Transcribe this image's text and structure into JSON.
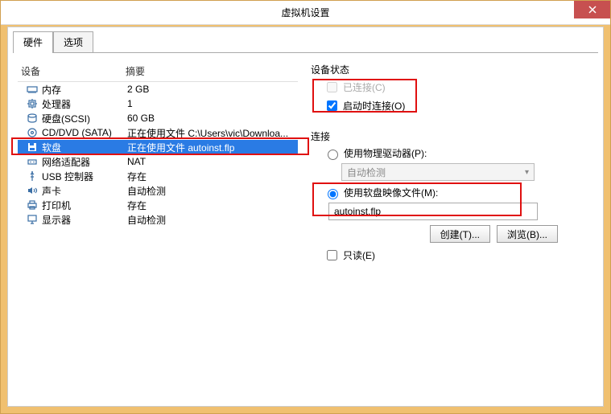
{
  "title": "虚拟机设置",
  "tabs": {
    "hardware": "硬件",
    "options": "选项"
  },
  "headers": {
    "device": "设备",
    "summary": "摘要"
  },
  "devices": [
    {
      "name": "内存",
      "summary": "2 GB",
      "icon": "memory"
    },
    {
      "name": "处理器",
      "summary": "1",
      "icon": "cpu"
    },
    {
      "name": "硬盘(SCSI)",
      "summary": "60 GB",
      "icon": "disk"
    },
    {
      "name": "CD/DVD (SATA)",
      "summary": "正在使用文件 C:\\Users\\vic\\Downloa...",
      "icon": "cd"
    },
    {
      "name": "软盘",
      "summary": "正在使用文件 autoinst.flp",
      "icon": "floppy"
    },
    {
      "name": "网络适配器",
      "summary": "NAT",
      "icon": "net"
    },
    {
      "name": "USB 控制器",
      "summary": "存在",
      "icon": "usb"
    },
    {
      "name": "声卡",
      "summary": "自动检测",
      "icon": "sound"
    },
    {
      "name": "打印机",
      "summary": "存在",
      "icon": "printer"
    },
    {
      "name": "显示器",
      "summary": "自动检测",
      "icon": "display"
    }
  ],
  "status": {
    "group": "设备状态",
    "connected": "已连接(C)",
    "connect_on_power": "启动时连接(O)"
  },
  "connection": {
    "group": "连接",
    "physical": "使用物理驱动器(P):",
    "auto_detect": "自动检测",
    "use_image": "使用软盘映像文件(M):",
    "image_path": "autoinst.flp",
    "create": "创建(T)...",
    "browse": "浏览(B)...",
    "readonly": "只读(E)"
  }
}
